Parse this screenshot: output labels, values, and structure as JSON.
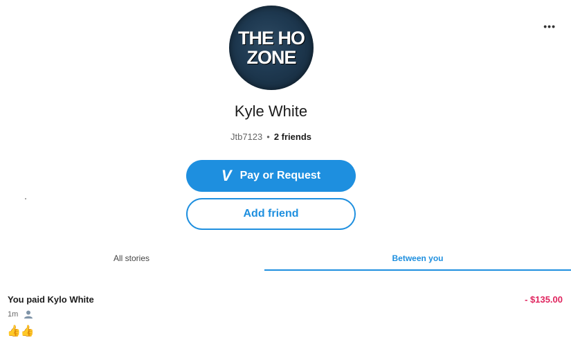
{
  "header": {
    "more_label": "•••"
  },
  "profile": {
    "avatar_line1": "THE HO",
    "avatar_line2": "ZONE",
    "name": "Kyle White",
    "username": "Jtb7123",
    "separator": "•",
    "friends": "2 friends"
  },
  "actions": {
    "pay_icon": "V",
    "pay_label": "Pay or Request",
    "add_friend_label": "Add friend"
  },
  "tabs": [
    {
      "label": "All stories",
      "active": false
    },
    {
      "label": "Between you",
      "active": true
    }
  ],
  "transaction": {
    "title": "You paid Kylo White",
    "amount": "- $135.00",
    "time": "1m",
    "reactions": "👍👍"
  },
  "colors": {
    "accent": "#1e8fdf",
    "negative_amount": "#e0245e"
  }
}
